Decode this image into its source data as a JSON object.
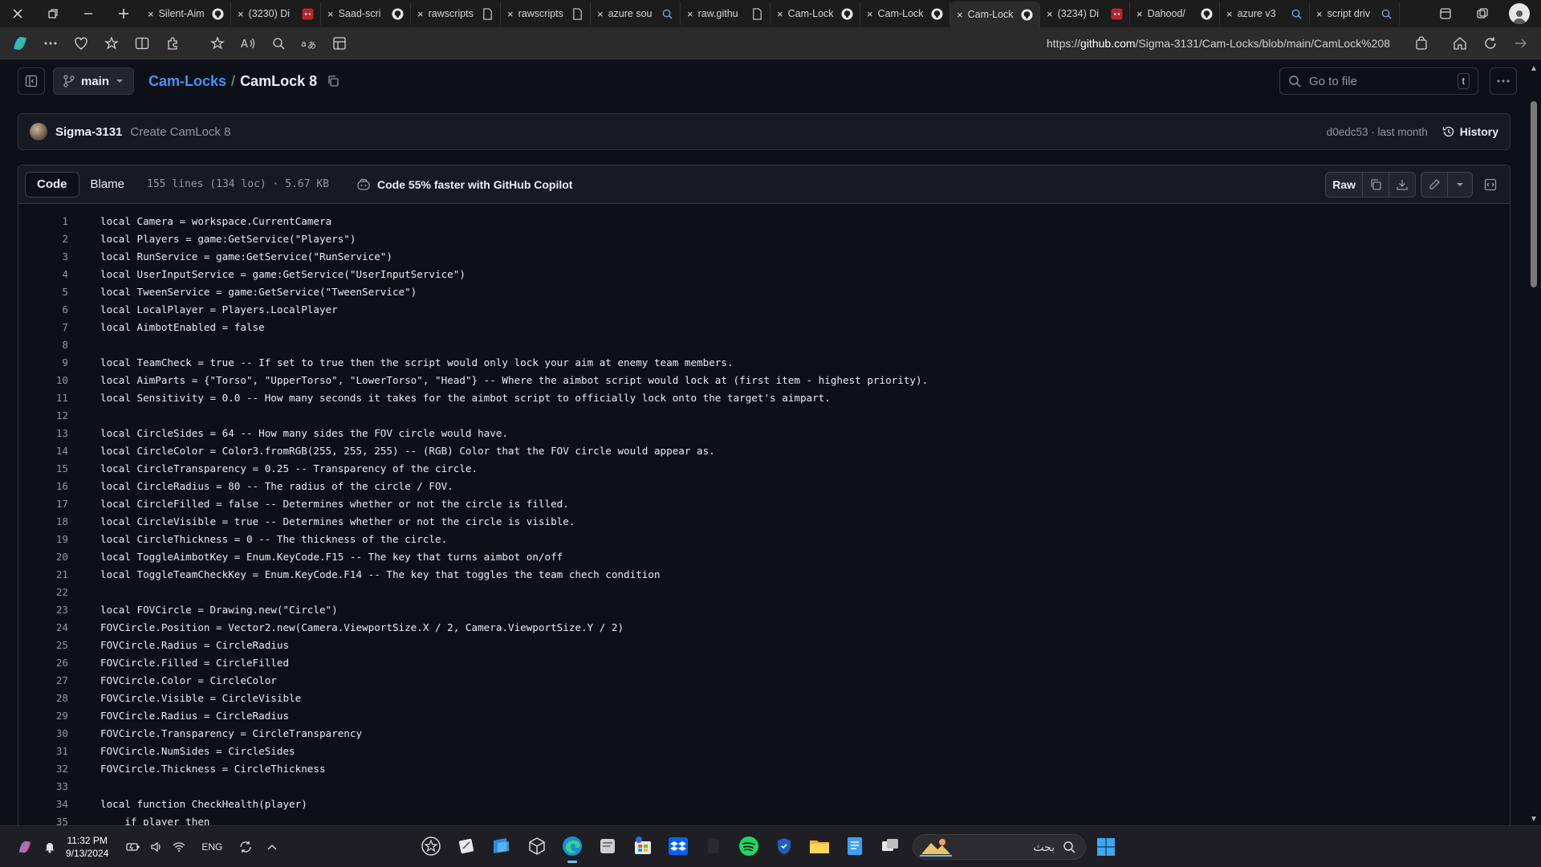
{
  "browser": {
    "tabs": [
      {
        "title": "Silent-Aim",
        "icon": "github-icon"
      },
      {
        "title": "(3230) Di",
        "icon": "discord-icon"
      },
      {
        "title": "Saad-scri",
        "icon": "github-icon"
      },
      {
        "title": "rawscripts",
        "icon": "page-icon"
      },
      {
        "title": "rawscripts",
        "icon": "page-icon"
      },
      {
        "title": "azure sou",
        "icon": "search-icon"
      },
      {
        "title": "raw.githu",
        "icon": "page-icon"
      },
      {
        "title": "Cam-Lock",
        "icon": "github-icon"
      },
      {
        "title": "Cam-Lock",
        "icon": "github-icon"
      },
      {
        "title": "Cam-Lock",
        "icon": "github-icon",
        "active": true
      },
      {
        "title": "(3234) Di",
        "icon": "discord-icon"
      },
      {
        "title": "Dahood/",
        "icon": "github-icon"
      },
      {
        "title": "azure v3",
        "icon": "search-icon"
      },
      {
        "title": "script driv",
        "icon": "search-icon"
      }
    ],
    "url_prefix": "https://",
    "url_host": "github.com",
    "url_path": "/Sigma-3131/Cam-Locks/blob/main/CamLock%208"
  },
  "repo": {
    "branch": "main",
    "name": "Cam-Locks",
    "separator": "/",
    "file": "CamLock 8",
    "goto_placeholder": "Go to file",
    "goto_shortcut": "t"
  },
  "commit": {
    "author": "Sigma-3131",
    "message": "Create CamLock 8",
    "meta": "d0edc53 · last month",
    "history_label": "History"
  },
  "file": {
    "tab_code": "Code",
    "tab_blame": "Blame",
    "info": "155 lines (134 loc) · 5.67 KB",
    "copilot": "Code 55% faster with GitHub Copilot",
    "raw_label": "Raw"
  },
  "code_lines": [
    "local Camera = workspace.CurrentCamera",
    "local Players = game:GetService(\"Players\")",
    "local RunService = game:GetService(\"RunService\")",
    "local UserInputService = game:GetService(\"UserInputService\")",
    "local TweenService = game:GetService(\"TweenService\")",
    "local LocalPlayer = Players.LocalPlayer",
    "local AimbotEnabled = false",
    "",
    "local TeamCheck = true -- If set to true then the script would only lock your aim at enemy team members.",
    "local AimParts = {\"Torso\", \"UpperTorso\", \"LowerTorso\", \"Head\"} -- Where the aimbot script would lock at (first item - highest priority).",
    "local Sensitivity = 0.0 -- How many seconds it takes for the aimbot script to officially lock onto the target's aimpart.",
    "",
    "local CircleSides = 64 -- How many sides the FOV circle would have.",
    "local CircleColor = Color3.fromRGB(255, 255, 255) -- (RGB) Color that the FOV circle would appear as.",
    "local CircleTransparency = 0.25 -- Transparency of the circle.",
    "local CircleRadius = 80 -- The radius of the circle / FOV.",
    "local CircleFilled = false -- Determines whether or not the circle is filled.",
    "local CircleVisible = true -- Determines whether or not the circle is visible.",
    "local CircleThickness = 0 -- The thickness of the circle.",
    "local ToggleAimbotKey = Enum.KeyCode.F15 -- The key that turns aimbot on/off",
    "local ToggleTeamCheckKey = Enum.KeyCode.F14 -- The key that toggles the team chech condition",
    "",
    "local FOVCircle = Drawing.new(\"Circle\")",
    "FOVCircle.Position = Vector2.new(Camera.ViewportSize.X / 2, Camera.ViewportSize.Y / 2)",
    "FOVCircle.Radius = CircleRadius",
    "FOVCircle.Filled = CircleFilled",
    "FOVCircle.Color = CircleColor",
    "FOVCircle.Visible = CircleVisible",
    "FOVCircle.Radius = CircleRadius",
    "FOVCircle.Transparency = CircleTransparency",
    "FOVCircle.NumSides = CircleSides",
    "FOVCircle.Thickness = CircleThickness",
    "",
    "local function CheckHealth(player)",
    "    if player then"
  ],
  "taskbar": {
    "time": "11:32 PM",
    "date": "9/13/2024",
    "lang": "ENG",
    "search_placeholder": "بحث"
  },
  "colors": {
    "accent_link": "#4493f8",
    "page_bg": "#0d1117",
    "header_bg": "#161b22",
    "border": "#30363d"
  }
}
